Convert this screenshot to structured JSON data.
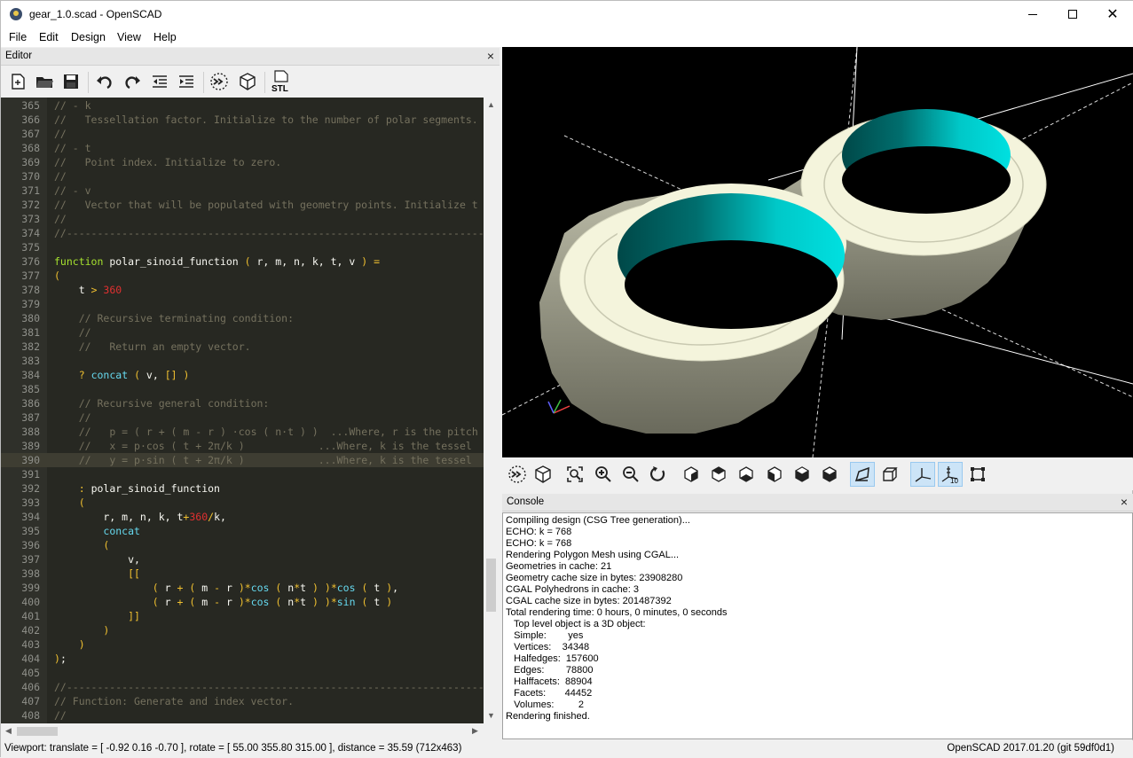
{
  "window": {
    "title": "gear_1.0.scad - OpenSCAD",
    "controls": {
      "minimize": "minimize-icon",
      "maximize": "maximize-icon",
      "close": "close-icon"
    }
  },
  "menu": [
    "File",
    "Edit",
    "Design",
    "View",
    "Help"
  ],
  "editor": {
    "title": "Editor",
    "close": "×",
    "toolbar_icons": [
      "new-file-icon",
      "open-file-icon",
      "save-icon",
      "undo-icon",
      "redo-icon",
      "unindent-icon",
      "indent-icon",
      "preview-icon",
      "render-icon",
      "export-stl-icon"
    ],
    "stl_label": "STL",
    "current_line": 390,
    "lines": [
      {
        "n": "365",
        "c": "// - k"
      },
      {
        "n": "366",
        "c": "//   Tessellation factor. Initialize to the number of polar segments."
      },
      {
        "n": "367",
        "c": "//"
      },
      {
        "n": "368",
        "c": "// - t"
      },
      {
        "n": "369",
        "c": "//   Point index. Initialize to zero."
      },
      {
        "n": "370",
        "c": "//"
      },
      {
        "n": "371",
        "c": "// - v"
      },
      {
        "n": "372",
        "c": "//   Vector that will be populated with geometry points. Initialize t"
      },
      {
        "n": "373",
        "c": "//"
      },
      {
        "n": "374",
        "c": "//-----------------------------------------------------------------------"
      },
      {
        "n": "375",
        "c": ""
      },
      {
        "n": "376",
        "c": "function polar_sinoid_function ( r, m, n, k, t, v ) ="
      },
      {
        "n": "377",
        "c": "("
      },
      {
        "n": "378",
        "c": "    t > 360"
      },
      {
        "n": "379",
        "c": ""
      },
      {
        "n": "380",
        "c": "    // Recursive terminating condition:"
      },
      {
        "n": "381",
        "c": "    //"
      },
      {
        "n": "382",
        "c": "    //   Return an empty vector."
      },
      {
        "n": "383",
        "c": ""
      },
      {
        "n": "384",
        "c": "    ? concat ( v, [] )"
      },
      {
        "n": "385",
        "c": ""
      },
      {
        "n": "386",
        "c": "    // Recursive general condition:"
      },
      {
        "n": "387",
        "c": "    //"
      },
      {
        "n": "388",
        "c": "    //   p = ( r + ( m - r ) ·cos ( n·t ) )  ...Where, r is the pitch"
      },
      {
        "n": "389",
        "c": "    //   x = p·cos ( t + 2π/k )            ...Where, k is the tessel"
      },
      {
        "n": "390",
        "c": "    //   y = p·sin ( t + 2π/k )            ...Where, k is the tessel"
      },
      {
        "n": "391",
        "c": ""
      },
      {
        "n": "392",
        "c": "    : polar_sinoid_function"
      },
      {
        "n": "393",
        "c": "    ("
      },
      {
        "n": "394",
        "c": "        r, m, n, k, t+360/k,"
      },
      {
        "n": "395",
        "c": "        concat"
      },
      {
        "n": "396",
        "c": "        ("
      },
      {
        "n": "397",
        "c": "            v,"
      },
      {
        "n": "398",
        "c": "            [["
      },
      {
        "n": "399",
        "c": "                ( r + ( m - r )*cos ( n*t ) )*cos ( t ),"
      },
      {
        "n": "400",
        "c": "                ( r + ( m - r )*cos ( n*t ) )*sin ( t )"
      },
      {
        "n": "401",
        "c": "            ]]"
      },
      {
        "n": "402",
        "c": "        )"
      },
      {
        "n": "403",
        "c": "    )"
      },
      {
        "n": "404",
        "c": ");"
      },
      {
        "n": "405",
        "c": ""
      },
      {
        "n": "406",
        "c": "//-----------------------------------------------------------------------"
      },
      {
        "n": "407",
        "c": "// Function: Generate and index vector."
      },
      {
        "n": "408",
        "c": "//"
      }
    ]
  },
  "viewport_toolbar_icons": [
    "preview-icon",
    "render-icon",
    "view-all-icon",
    "zoom-in-icon",
    "zoom-out-icon",
    "reset-view-icon",
    "view-right-icon",
    "view-top-icon",
    "view-bottom-icon",
    "view-left-icon",
    "view-front-icon",
    "view-back-icon",
    "perspective-icon",
    "orthogonal-icon",
    "show-axes-icon",
    "show-scale-markers-icon",
    "show-edges-icon"
  ],
  "console": {
    "title": "Console",
    "close": "×",
    "lines": [
      "Compiling design (CSG Tree generation)...",
      "ECHO: k = 768",
      "ECHO: k = 768",
      "Rendering Polygon Mesh using CGAL...",
      "Geometries in cache: 21",
      "Geometry cache size in bytes: 23908280",
      "CGAL Polyhedrons in cache: 3",
      "CGAL cache size in bytes: 201487392",
      "Total rendering time: 0 hours, 0 minutes, 0 seconds",
      "   Top level object is a 3D object:",
      "   Simple:        yes",
      "   Vertices:    34348",
      "   Halfedges:  157600",
      "   Edges:        78800",
      "   Halffacets:  88904",
      "   Facets:       44452",
      "   Volumes:         2",
      "Rendering finished."
    ]
  },
  "status": {
    "viewport": "Viewport: translate = [ -0.92 0.16 -0.70 ], rotate = [ 55.00 355.80 315.00 ], distance = 35.59 (712x463)",
    "version": "OpenSCAD 2017.01.20 (git 59df0d1)"
  },
  "colors": {
    "code_bg": "#272822",
    "comment": "#75715e",
    "keyword": "#a6e22e",
    "builtin": "#66d9ef",
    "number": "#e03030",
    "paren": "#f0c030",
    "gear_face": "#f4f4dc",
    "gear_bore": "#00d8d8"
  }
}
